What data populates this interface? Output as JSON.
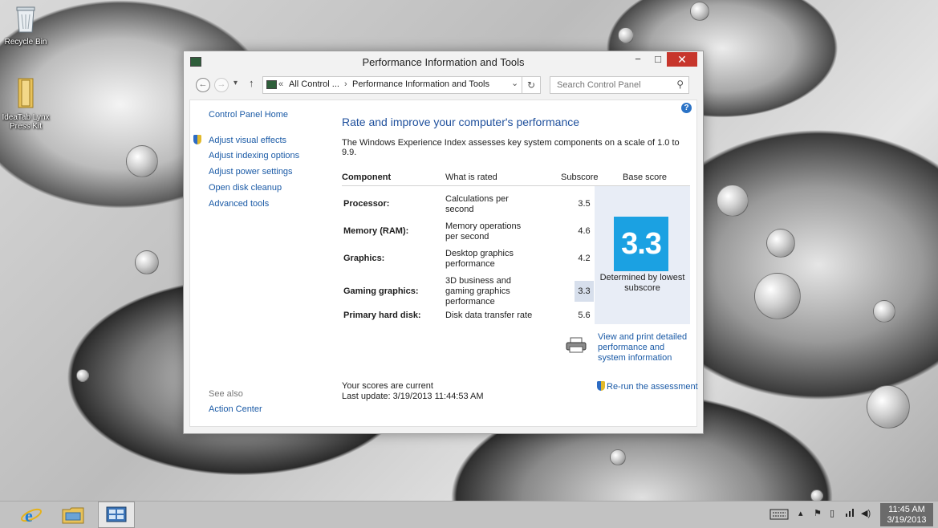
{
  "desktop": {
    "icons": [
      {
        "label": "Recycle Bin"
      },
      {
        "label": "IdeaTab Lynx Press Kit"
      }
    ]
  },
  "window": {
    "title": "Performance Information and Tools",
    "controls": {
      "minimize": "−",
      "maximize": "□",
      "close": "✕"
    }
  },
  "navbar": {
    "back": "←",
    "forward": "→",
    "recent": "▾",
    "up": "↑",
    "breadcrumb": {
      "chevrons": "«",
      "parent": "All Control ...",
      "separator": "›",
      "current": "Performance Information and Tools",
      "dropdown": "⌄"
    },
    "refresh": "↻",
    "search_placeholder": "Search Control Panel"
  },
  "sidebar": {
    "home": "Control Panel Home",
    "items": [
      {
        "label": "Adjust visual effects",
        "shield": true
      },
      {
        "label": "Adjust indexing options"
      },
      {
        "label": "Adjust power settings"
      },
      {
        "label": "Open disk cleanup"
      },
      {
        "label": "Advanced tools"
      }
    ],
    "see_also": "See also",
    "see_also_items": [
      "Action Center"
    ]
  },
  "main": {
    "help": "?",
    "heading": "Rate and improve your computer's performance",
    "description": "The Windows Experience Index assesses key system components on a scale of 1.0 to 9.9.",
    "table": {
      "headers": [
        "Component",
        "What is rated",
        "Subscore",
        "Base score"
      ],
      "rows": [
        {
          "component": "Processor:",
          "what": "Calculations per second",
          "subscore": "3.5"
        },
        {
          "component": "Memory (RAM):",
          "what": "Memory operations per second",
          "subscore": "4.6"
        },
        {
          "component": "Graphics:",
          "what": "Desktop graphics performance",
          "subscore": "4.2"
        },
        {
          "component": "Gaming graphics:",
          "what": "3D business and gaming graphics performance",
          "subscore": "3.3"
        },
        {
          "component": "Primary hard disk:",
          "what": "Disk data transfer rate",
          "subscore": "5.6"
        }
      ],
      "base_score": "3.3",
      "base_note": "Determined by lowest subscore",
      "badge_color": "#1ba1e2"
    },
    "print_link": "View and print detailed performance and system information",
    "status_line1": "Your scores are current",
    "status_line2": "Last update: 3/19/2013 11:44:53 AM",
    "rerun": "Re-run the assessment"
  },
  "taskbar": {
    "clock_time": "11:45 AM",
    "clock_date": "3/19/2013"
  }
}
